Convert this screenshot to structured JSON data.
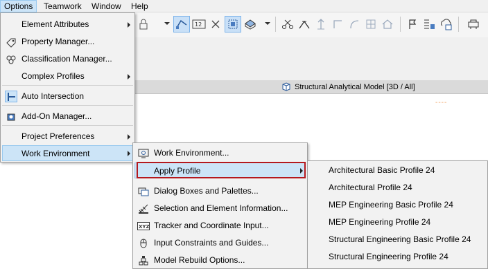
{
  "menubar": {
    "items": [
      {
        "label": "Options"
      },
      {
        "label": "Teamwork"
      },
      {
        "label": "Window"
      },
      {
        "label": "Help"
      }
    ]
  },
  "tab": {
    "label": "Structural Analytical Model  [3D / All]"
  },
  "options_menu": {
    "items": [
      {
        "label": "Element Attributes",
        "submenu": true
      },
      {
        "label": "Property Manager...",
        "icon": "property-manager-icon"
      },
      {
        "label": "Classification Manager...",
        "icon": "classification-manager-icon"
      },
      {
        "label": "Complex Profiles",
        "submenu": true
      },
      {
        "label": "Auto Intersection",
        "icon": "auto-intersection-icon"
      },
      {
        "label": "Add-On Manager...",
        "icon": "addon-manager-icon"
      },
      {
        "label": "Project Preferences",
        "submenu": true
      },
      {
        "label": "Work Environment",
        "submenu": true,
        "highlighted": true
      }
    ]
  },
  "work_env_menu": {
    "items": [
      {
        "label": "Work Environment...",
        "icon": "work-environment-icon"
      },
      {
        "label": "Apply Profile",
        "submenu": true,
        "highlighted": true
      },
      {
        "label": "Dialog Boxes and Palettes...",
        "icon": "dialog-boxes-icon"
      },
      {
        "label": "Selection and Element Information...",
        "icon": "selection-info-icon"
      },
      {
        "label": "Tracker and Coordinate Input...",
        "icon": "tracker-icon"
      },
      {
        "label": "Input Constraints and Guides...",
        "icon": "input-constraints-icon"
      },
      {
        "label": "Model Rebuild Options...",
        "icon": "model-rebuild-icon"
      }
    ]
  },
  "profile_menu": {
    "items": [
      {
        "label": "Architectural Basic Profile 24"
      },
      {
        "label": "Architectural Profile 24"
      },
      {
        "label": "MEP Engineering Basic Profile 24"
      },
      {
        "label": "MEP Engineering Profile 24"
      },
      {
        "label": "Structural Engineering Basic Profile 24"
      },
      {
        "label": "Structural Engineering Profile 24"
      }
    ]
  },
  "colors": {
    "highlight": "#cce4f7",
    "annotation_red": "#b4191e"
  }
}
